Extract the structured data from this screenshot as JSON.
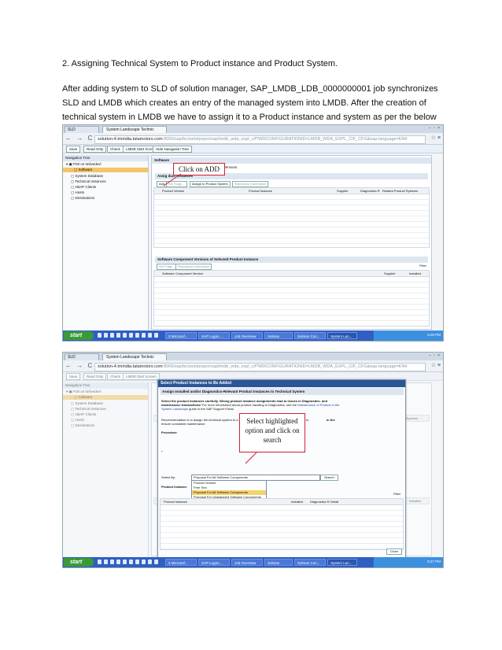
{
  "document": {
    "heading": "2. Assigning Technical System to Product instance and Product System.",
    "paragraph": "After adding system to SLD of solution manager, SAP_LMDB_LDB_0000000001 job synchronizes SLD and LMDB which creates an entry of the managed system into LMDB. After the creation of technical system in LMDB we have to assign it to a Product instance and system as per the below screen shots."
  },
  "browser": {
    "tab_first": "SLD",
    "tab_active": "System Landscape Technic",
    "url_host": "solution-4.tmindia.tatamotors.com",
    "url_path": ":8000/sap/bc/webdynpro/sap/lmdb_wda_expl_cif?WDCONFIGURATIONID=LMDB_WDA_EXPL_CIF_CFG&sap-language=EN#"
  },
  "toolbar": {
    "save": "Save",
    "read_only": "Read Only",
    "check": "Check",
    "lmdb_start": "LMDB Start Screen",
    "hide_nav": "Hide Navigation Tree"
  },
  "nav_tree": {
    "title": "Navigation Tree",
    "root": "P28 on tmlivedevl",
    "items": [
      "Software",
      "System Database",
      "Technical Instances",
      "ABAP Clients",
      "Hosts",
      "Destinations"
    ]
  },
  "shot1": {
    "software_header": "Software",
    "tab_suffix": "ponent Versions",
    "assign_header": "Assig        duct Instances",
    "buttons": [
      "Add",
      "Set Flags ...",
      "Assign to Product System",
      "Repository Information"
    ],
    "columns": [
      "Product Version",
      "Product Instance",
      "Supplier",
      "Diagnostics R",
      "Related Product Systems"
    ],
    "swc_header": "Software Component Versions of Selected Product Instance",
    "swc_buttons": [
      "Set Flags ...",
      "Repository Information"
    ],
    "swc_filter": "Filter",
    "swc_columns": [
      "Software Component Version",
      "Supplier",
      "Installed"
    ],
    "callout": "Click on ADD"
  },
  "shot2": {
    "dialog_title": "Select Product Instances to Be Added",
    "dialog_sub": "Assign Installed and/or Diagnostics-Relevant Product Instances to Technical System",
    "instructions_1": "Select the product instances carefully. Wrong product instance assignments lead to issues in Diagnostics- and maintenance transactions!",
    "instructions_2": "For more information about product handling in Diagnostics, see the",
    "instructions_link": "Maintenance of Product in the System Landscape",
    "instructions_3": "guide in the SAP Support Portal.",
    "recommendation": "Recommendation is to assign the technical system to a product system. Use the Product System Editor to ensure consistent maintenance.",
    "in_the": "in the",
    "procedure": "Procedure",
    "select_by_label": "Select By:",
    "select_by_value": "Proposal For All Software Components",
    "dropdown_options": [
      "Product Version",
      "Free Text",
      "Proposal For All Software Components",
      "Proposal For Unassigned Software Components"
    ],
    "search_button": "Search",
    "product_instance_tab": "Product Instance",
    "filter": "Filter",
    "result_columns": [
      "Product Instance",
      "Installed",
      "Diagnostics R",
      "Detail"
    ],
    "close_button": "Close",
    "right_columns": [
      "Diagnostics R",
      "Related Product Systems"
    ],
    "right_cols2": [
      "Supplier",
      "Installed"
    ],
    "callout": "Select highlighted option and click on search"
  },
  "taskbar": {
    "start": "start",
    "tasks1": [
      "3 Microsof...",
      "SAP Logon ...",
      "Job Overview",
      "Solman",
      "Solman Con...",
      "System Lan..."
    ],
    "clock1": "5:26 PM",
    "clock2": "5:27 PM"
  }
}
